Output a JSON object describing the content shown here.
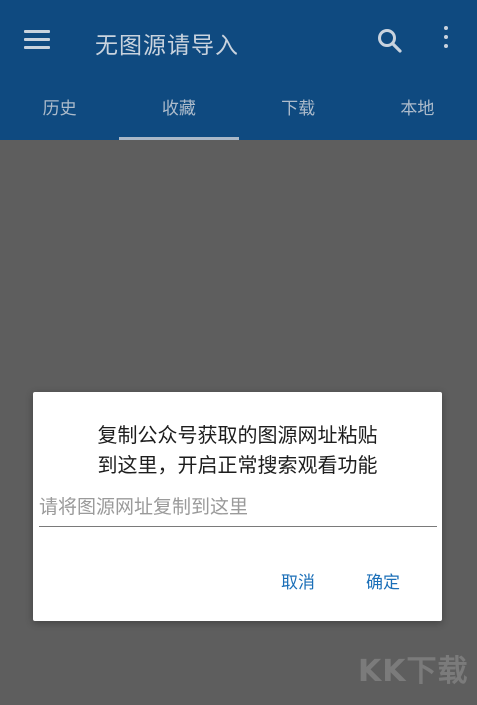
{
  "header": {
    "title": "无图源请导入",
    "menu_icon": "hamburger-menu-icon",
    "search_icon": "search-icon",
    "more_icon": "more-vert-icon"
  },
  "tabs": [
    {
      "label": "历史",
      "active": false
    },
    {
      "label": "收藏",
      "active": true
    },
    {
      "label": "下载",
      "active": false
    },
    {
      "label": "本地",
      "active": false
    }
  ],
  "dialog": {
    "message_line1": "复制公众号获取的图源网址粘贴",
    "message_line2": "到这里，开启正常搜索观看功能",
    "input_placeholder": "请将图源网址复制到这里",
    "input_value": "",
    "cancel_label": "取消",
    "ok_label": "确定"
  },
  "watermark": "KK下载",
  "colors": {
    "appbar": "#0f4a80",
    "scrim": "#5e5e5e",
    "accent": "#1b6fb8"
  }
}
